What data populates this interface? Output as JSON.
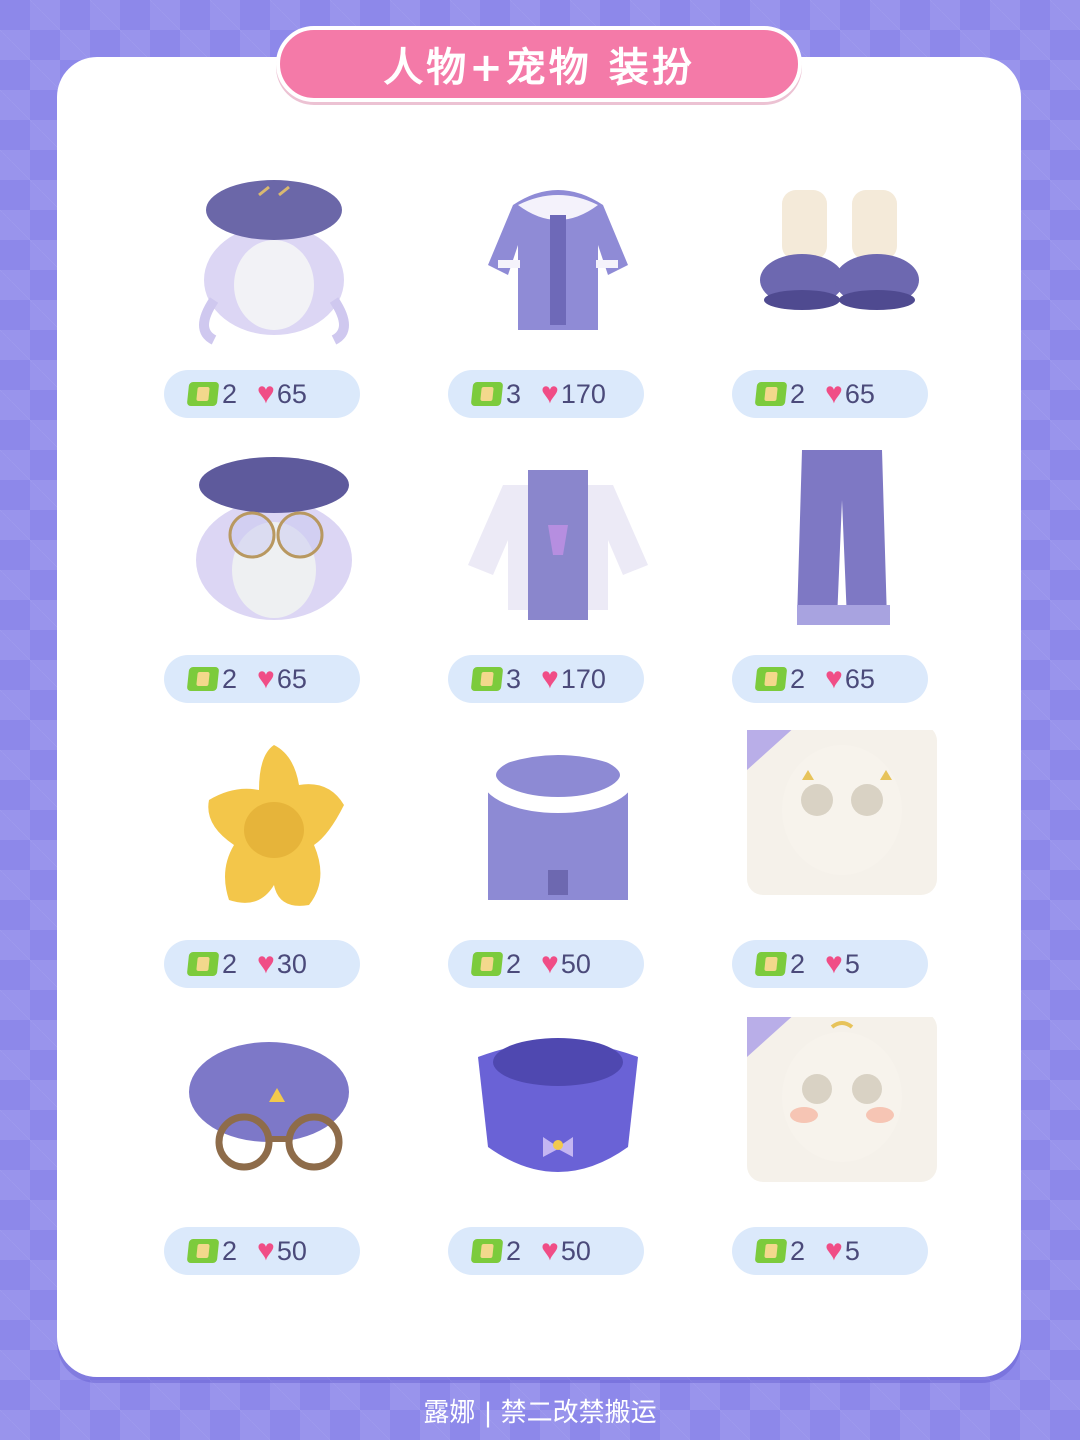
{
  "title": "人物+宠物 装扮",
  "footer": "露娜 | 禁二改禁搬运",
  "colors": {
    "background": "#8d88ea",
    "title_pill": "#f47aa8",
    "price_pill": "#dbe9fb",
    "ticket": "#7ccb3c",
    "heart": "#f04d86"
  },
  "items": [
    {
      "name": "beret-hair-wig",
      "tickets": "2",
      "hearts": "65"
    },
    {
      "name": "hooded-jacket-outfit",
      "tickets": "3",
      "hearts": "170"
    },
    {
      "name": "sneakers-legwarmers",
      "tickets": "2",
      "hearts": "65"
    },
    {
      "name": "glasses-beret-hair",
      "tickets": "2",
      "hearts": "65"
    },
    {
      "name": "scarf-jacket",
      "tickets": "3",
      "hearts": "170"
    },
    {
      "name": "wide-pants",
      "tickets": "2",
      "hearts": "65"
    },
    {
      "name": "yellow-star-pillow",
      "tickets": "2",
      "hearts": "30"
    },
    {
      "name": "collar-cape",
      "tickets": "2",
      "hearts": "50"
    },
    {
      "name": "face-makeup-sparkle",
      "tickets": "2",
      "hearts": "5"
    },
    {
      "name": "pet-beret-glasses",
      "tickets": "2",
      "hearts": "50"
    },
    {
      "name": "pet-collar-bow",
      "tickets": "2",
      "hearts": "50"
    },
    {
      "name": "face-makeup-blush",
      "tickets": "2",
      "hearts": "5"
    }
  ]
}
